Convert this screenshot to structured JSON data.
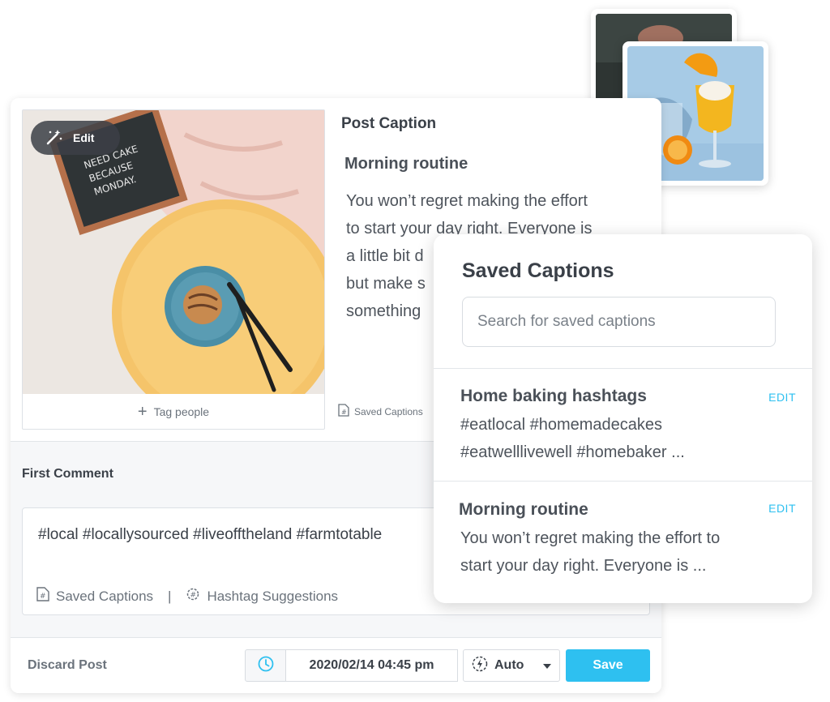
{
  "post": {
    "edit_label": "Edit",
    "tag_people_label": "Tag people",
    "letterboard_text": "NEED CAKE BECAUSE MONDAY.",
    "caption_section_title": "Post Caption",
    "caption_heading": "Morning routine",
    "caption_lines": [
      "You won’t regret making the effort",
      "to start your day right. Everyone is",
      "a little bit d",
      "but make s",
      "something"
    ],
    "saved_captions_link": "Saved Captions"
  },
  "first_comment": {
    "label": "First Comment",
    "text": "#local #locallysourced #liveofftheland #farmtotable",
    "saved_captions_label": "Saved Captions",
    "separator": "|",
    "hashtag_suggestions_label": "Hashtag Suggestions"
  },
  "footer": {
    "discard_label": "Discard Post",
    "datetime_value": "2020/02/14 04:45 pm",
    "auto_label": "Auto",
    "save_label": "Save"
  },
  "saved_captions_panel": {
    "title": "Saved Captions",
    "search_placeholder": "Search for saved captions",
    "entries": [
      {
        "title": "Home baking hashtags",
        "edit_label": "EDIT",
        "line1": "#eatlocal #homemadecakes",
        "line2": "#eatwelllivewell #homebaker ..."
      },
      {
        "title": "Morning routine",
        "edit_label": "EDIT",
        "line1": "You won’t regret making the effort to",
        "line2": "start your day right. Everyone is ..."
      }
    ]
  },
  "colors": {
    "accent": "#2ec0f0",
    "text_dark": "#3a4048",
    "text_muted": "#6b737c",
    "panel_bg": "#f6f7f9"
  }
}
